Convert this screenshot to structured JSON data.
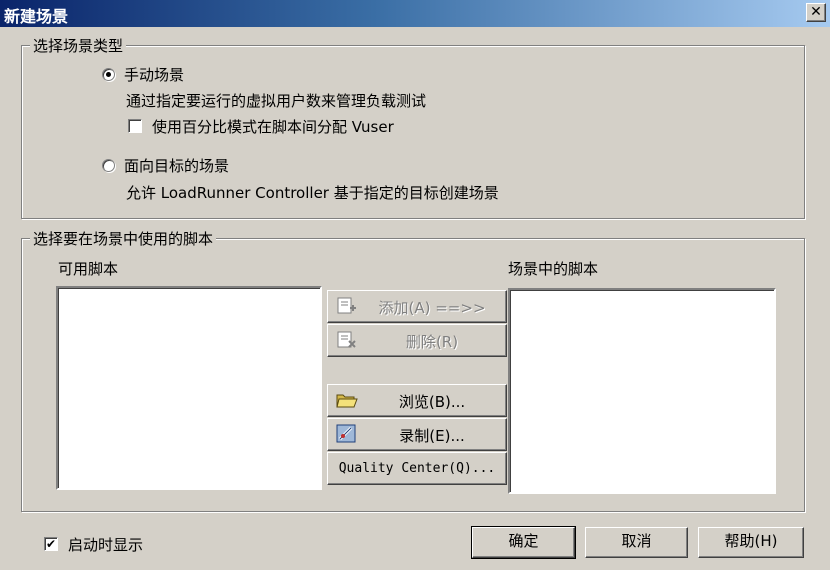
{
  "window": {
    "title": "新建场景",
    "close_glyph": "✕"
  },
  "scenario_type": {
    "group_title": "选择场景类型",
    "manual": {
      "label": "手动场景",
      "selected": true,
      "description": "通过指定要运行的虚拟用户数来管理负载测试",
      "percent_mode": {
        "label": "使用百分比模式在脚本间分配 Vuser",
        "checked": false
      }
    },
    "goal": {
      "label": "面向目标的场景",
      "selected": false,
      "description": "允许 LoadRunner Controller 基于指定的目标创建场景"
    }
  },
  "scripts": {
    "group_title": "选择要在场景中使用的脚本",
    "available_label": "可用脚本",
    "in_scenario_label": "场景中的脚本",
    "available_items": [],
    "scenario_items": [],
    "buttons": {
      "add": {
        "label": "添加",
        "accel": "(A)",
        "suffix": " ==>>",
        "icon": "add-script-icon",
        "enabled": false
      },
      "remove": {
        "label": "删除",
        "accel": "(R)",
        "icon": "remove-script-icon",
        "enabled": false
      },
      "browse": {
        "label": "浏览",
        "accel": "(B)",
        "suffix": "...",
        "icon": "open-folder-icon",
        "enabled": true
      },
      "record": {
        "label": "录制",
        "accel": "(E)",
        "suffix": "...",
        "icon": "record-icon",
        "enabled": true
      },
      "quality_center": {
        "label": "Quality Center",
        "accel": "(Q)",
        "suffix": "...",
        "enabled": true
      }
    }
  },
  "footer": {
    "show_on_startup": {
      "label": "启动时显示",
      "checked": true
    },
    "ok": "确定",
    "cancel": "取消",
    "help": {
      "label": "帮助",
      "accel": "(H)"
    }
  }
}
